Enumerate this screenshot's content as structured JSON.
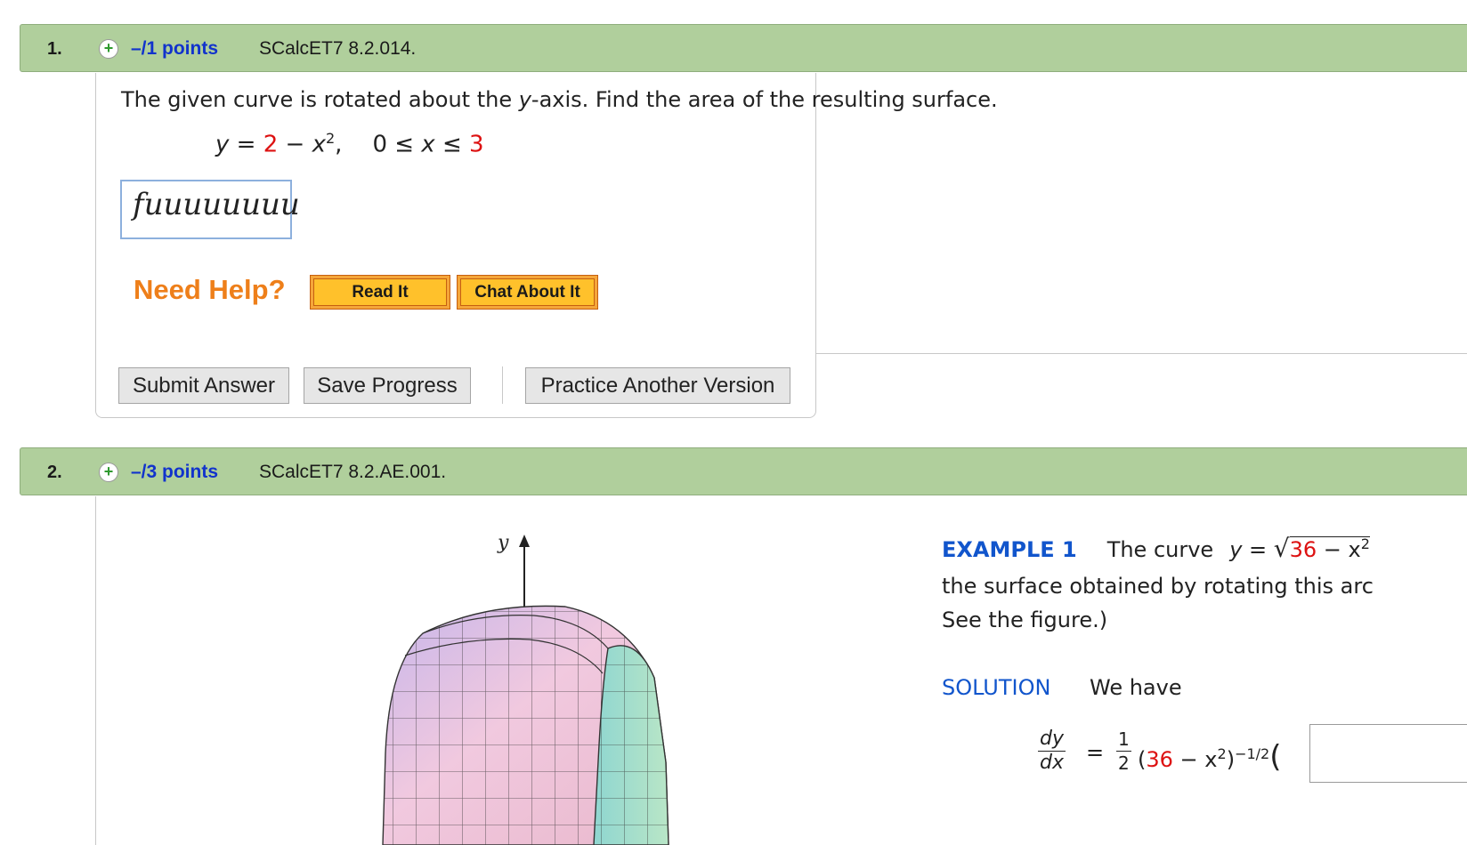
{
  "questions": [
    {
      "number": "1.",
      "plus_icon": "+",
      "points": "–/1 points",
      "reference": "SCalcET7 8.2.014.",
      "prompt_a": "The given curve is rotated about the ",
      "prompt_var": "y",
      "prompt_b": "-axis. Find the area of the resulting surface.",
      "formula": {
        "y": "y",
        "eq": " = ",
        "a": "2",
        "minus": " − ",
        "x": "x",
        "exp": "2",
        "comma": ",",
        "lhs": "0 ≤ ",
        "xv": "x",
        "le": " ≤ ",
        "b": "3"
      },
      "answer_value": "fuuuuuuuu",
      "need_help": "Need Help?",
      "read_it": "Read It",
      "chat_about_it": "Chat About It",
      "submit": "Submit Answer",
      "save": "Save Progress",
      "practice": "Practice Another Version"
    },
    {
      "number": "2.",
      "plus_icon": "+",
      "points": "–/3 points",
      "reference": "SCalcET7 8.2.AE.001.",
      "figure_axis_label": "y",
      "example_title": "EXAMPLE 1",
      "example_text": "The curve",
      "example_y": "y",
      "example_eq": " = ",
      "example_sqrt_a": "36",
      "example_sqrt_b": " − x",
      "example_sqrt_exp": "2",
      "line2": "the surface obtained by rotating this arc",
      "line3": "See the figure.)",
      "solution_label": "SOLUTION",
      "we_have": "We have",
      "dy": "dy",
      "dx": "dx",
      "eq": "=",
      "half_num": "1",
      "half_den": "2",
      "expr_open": "(",
      "expr_36": "36",
      "expr_mid": " − x",
      "expr_exp1": "2",
      "expr_close": ")",
      "expr_exp2": "−1/2",
      "expr_paren": "("
    }
  ],
  "colors": {
    "header_bar": "#b0cf9c",
    "points_blue": "#1133cc",
    "red": "#dd1111",
    "need_help_orange": "#ee7f1a",
    "help_button": "#ffc12b"
  }
}
